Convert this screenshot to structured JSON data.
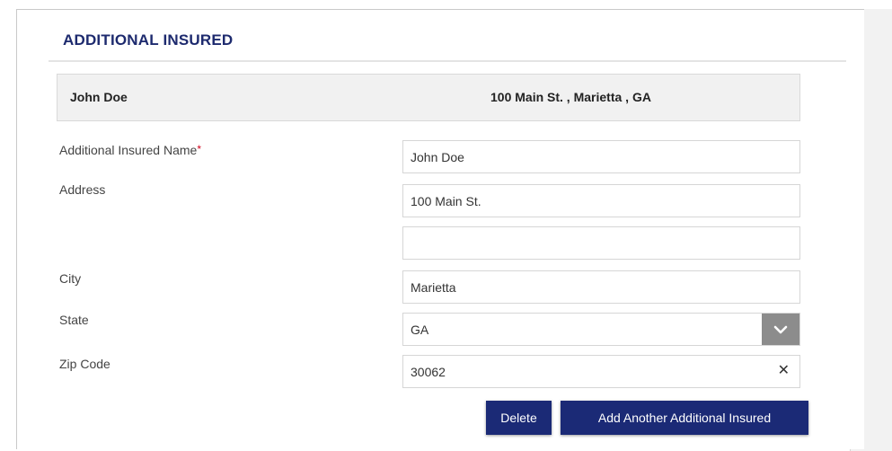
{
  "section": {
    "title": "ADDITIONAL INSURED"
  },
  "summary": {
    "name": "John Doe",
    "address": "100 Main St. , Marietta , GA"
  },
  "form": {
    "name_label": "Additional Insured Name",
    "required_mark": "*",
    "name_value": "John Doe",
    "address_label": "Address",
    "address_line1_value": "100 Main St.",
    "address_line2_value": "",
    "city_label": "City",
    "city_value": "Marietta",
    "state_label": "State",
    "state_value": "GA",
    "zip_label": "Zip Code",
    "zip_value": "30062",
    "clear_glyph": "✕"
  },
  "buttons": {
    "delete": "Delete",
    "add_another": "Add Another Additional Insured"
  },
  "icons": {
    "state_dropdown": "chevron-down-icon",
    "zip_clear": "close-icon"
  },
  "colors": {
    "primary": "#1b2a76",
    "title": "#1d2a6e",
    "required": "#d0021b",
    "dropdown_caret_bg": "#8c8c8c"
  }
}
